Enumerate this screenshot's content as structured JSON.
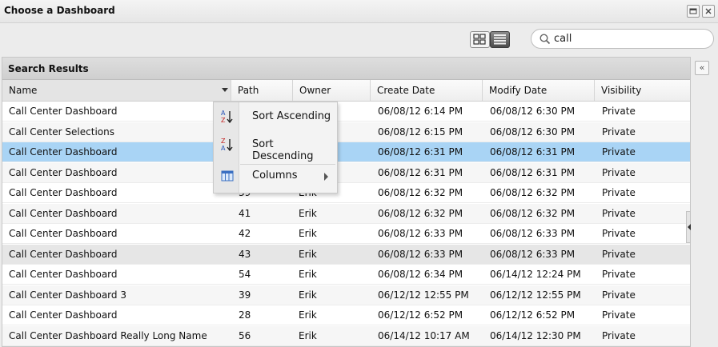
{
  "window": {
    "title": "Choose a Dashboard",
    "restore_icon": "restore-icon",
    "close_icon": "close-icon"
  },
  "toolbar": {
    "view_toggle": {
      "active": "list",
      "options": [
        "grid-view",
        "list-view"
      ]
    },
    "search": {
      "value": "call",
      "icon": "search-icon"
    }
  },
  "panel": {
    "title": "Search Results",
    "collapse_icon": "double-chevron-left-icon"
  },
  "table": {
    "columns": [
      "Name",
      "Path",
      "Owner",
      "Create Date",
      "Modify Date",
      "Visibility"
    ],
    "sorted_column": "Name",
    "rows": [
      {
        "name": "Call Center Dashboard",
        "path": "",
        "owner": "",
        "create": "06/08/12 6:14 PM",
        "modify": "06/08/12 6:30 PM",
        "vis": "Private"
      },
      {
        "name": "Call Center Selections",
        "path": "",
        "owner": "",
        "create": "06/08/12 6:15 PM",
        "modify": "06/08/12 6:30 PM",
        "vis": "Private"
      },
      {
        "name": "Call Center Dashboard",
        "path": "",
        "owner": "",
        "create": "06/08/12 6:31 PM",
        "modify": "06/08/12 6:31 PM",
        "vis": "Private"
      },
      {
        "name": "Call Center Dashboard",
        "path": "",
        "owner": "",
        "create": "06/08/12 6:31 PM",
        "modify": "06/08/12 6:31 PM",
        "vis": "Private"
      },
      {
        "name": "Call Center Dashboard",
        "path": "39",
        "owner": "Erik",
        "create": "06/08/12 6:32 PM",
        "modify": "06/08/12 6:32 PM",
        "vis": "Private"
      },
      {
        "name": "Call Center Dashboard",
        "path": "41",
        "owner": "Erik",
        "create": "06/08/12 6:32 PM",
        "modify": "06/08/12 6:32 PM",
        "vis": "Private"
      },
      {
        "name": "Call Center Dashboard",
        "path": "42",
        "owner": "Erik",
        "create": "06/08/12 6:33 PM",
        "modify": "06/08/12 6:33 PM",
        "vis": "Private"
      },
      {
        "name": "Call Center Dashboard",
        "path": "43",
        "owner": "Erik",
        "create": "06/08/12 6:33 PM",
        "modify": "06/08/12 6:33 PM",
        "vis": "Private"
      },
      {
        "name": "Call Center Dashboard",
        "path": "54",
        "owner": "Erik",
        "create": "06/08/12 6:34 PM",
        "modify": "06/14/12 12:24 PM",
        "vis": "Private"
      },
      {
        "name": "Call Center Dashboard 3",
        "path": "39",
        "owner": "Erik",
        "create": "06/12/12 12:55 PM",
        "modify": "06/12/12 12:55 PM",
        "vis": "Private"
      },
      {
        "name": "Call Center Dashboard",
        "path": "28",
        "owner": "Erik",
        "create": "06/12/12 6:52 PM",
        "modify": "06/12/12 6:52 PM",
        "vis": "Private"
      },
      {
        "name": "Call Center Dashboard Really Long Name",
        "path": "56",
        "owner": "Erik",
        "create": "06/14/12 10:17 AM",
        "modify": "06/14/12 12:30 PM",
        "vis": "Private"
      }
    ],
    "selected_row": 2,
    "hovered_row": 7
  },
  "context_menu": {
    "items": [
      {
        "label": "Sort Ascending",
        "icon": "sort-ascending-icon"
      },
      {
        "label": "Sort Descending",
        "icon": "sort-descending-icon"
      },
      {
        "label": "Columns",
        "icon": "columns-icon",
        "submenu": true
      }
    ]
  },
  "colors": {
    "selection": "#a9d4f5",
    "hover_row": "#e6e6e6",
    "panel_header": "#d4d4d4"
  }
}
